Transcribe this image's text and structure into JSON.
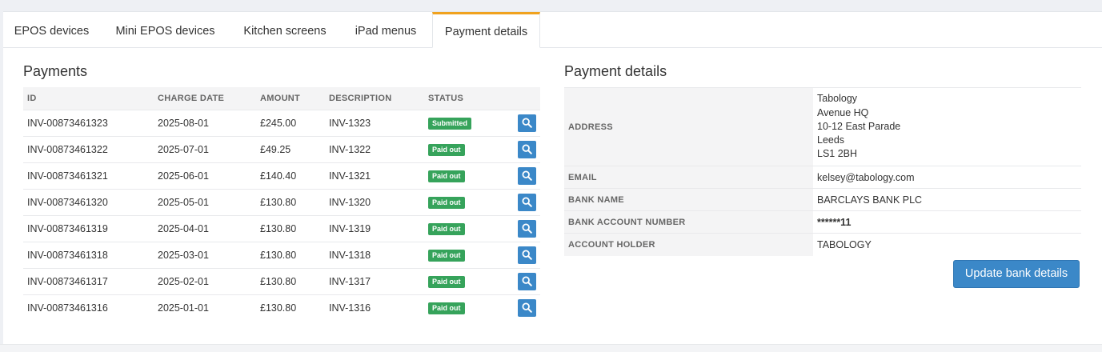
{
  "tabs": [
    {
      "label": "EPOS devices"
    },
    {
      "label": "Mini EPOS devices"
    },
    {
      "label": "Kitchen screens"
    },
    {
      "label": "iPad menus"
    },
    {
      "label": "Payment details",
      "active": true
    }
  ],
  "payments": {
    "title": "Payments",
    "columns": [
      "ID",
      "CHARGE DATE",
      "AMOUNT",
      "DESCRIPTION",
      "STATUS"
    ],
    "rows": [
      {
        "id": "INV-00873461323",
        "date": "2025-08-01",
        "amount": "£245.00",
        "desc": "INV-1323",
        "status": "Submitted"
      },
      {
        "id": "INV-00873461322",
        "date": "2025-07-01",
        "amount": "£49.25",
        "desc": "INV-1322",
        "status": "Paid out"
      },
      {
        "id": "INV-00873461321",
        "date": "2025-06-01",
        "amount": "£140.40",
        "desc": "INV-1321",
        "status": "Paid out"
      },
      {
        "id": "INV-00873461320",
        "date": "2025-05-01",
        "amount": "£130.80",
        "desc": "INV-1320",
        "status": "Paid out"
      },
      {
        "id": "INV-00873461319",
        "date": "2025-04-01",
        "amount": "£130.80",
        "desc": "INV-1319",
        "status": "Paid out"
      },
      {
        "id": "INV-00873461318",
        "date": "2025-03-01",
        "amount": "£130.80",
        "desc": "INV-1318",
        "status": "Paid out"
      },
      {
        "id": "INV-00873461317",
        "date": "2025-02-01",
        "amount": "£130.80",
        "desc": "INV-1317",
        "status": "Paid out"
      },
      {
        "id": "INV-00873461316",
        "date": "2025-01-01",
        "amount": "£130.80",
        "desc": "INV-1316",
        "status": "Paid out"
      }
    ],
    "view_icon": "search-icon"
  },
  "details": {
    "title": "Payment details",
    "address_label": "ADDRESS",
    "address_lines": [
      "Tabology",
      "Avenue HQ",
      "10-12 East Parade",
      "Leeds",
      "LS1 2BH"
    ],
    "email_label": "EMAIL",
    "email": "kelsey@tabology.com",
    "bank_name_label": "BANK NAME",
    "bank_name": "BARCLAYS BANK PLC",
    "account_number_label": "BANK ACCOUNT NUMBER",
    "account_number": "******11",
    "holder_label": "ACCOUNT HOLDER",
    "holder": "TABOLOGY",
    "update_button": "Update bank details"
  },
  "colors": {
    "accent_tab": "#f0a21e",
    "button_blue": "#3b88c8",
    "status_green": "#36a35b"
  }
}
